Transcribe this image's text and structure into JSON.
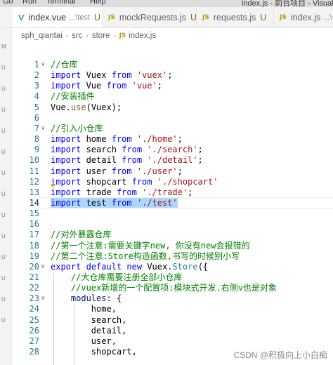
{
  "menubar": {
    "items": [
      "Go",
      "Run",
      "Terminal",
      "Help"
    ],
    "title": "index.js - 前台项目 - Visual S"
  },
  "tabs": [
    {
      "icon": "V",
      "kind": "vue",
      "label": "index.vue",
      "path": "...\\test",
      "modified": "U",
      "active": false
    },
    {
      "icon": "JS",
      "kind": "js",
      "label": "mockRequests.js",
      "path": "",
      "modified": "U",
      "active": false
    },
    {
      "icon": "JS",
      "kind": "js",
      "label": "requests.js",
      "path": "",
      "modified": "U",
      "active": false
    },
    {
      "icon": "JS",
      "kind": "js",
      "label": "index.js",
      "path": "...\\",
      "modified": "",
      "active": true
    }
  ],
  "breadcrumb": {
    "segments": [
      "sph_qiantai",
      "src",
      "store"
    ],
    "file_icon": "JS",
    "file": "index.js"
  },
  "editor": {
    "current_line": 14,
    "lines": [
      {
        "n": 1,
        "tokens": [
          [
            "cmt",
            "//仓库"
          ]
        ]
      },
      {
        "n": 2,
        "tokens": [
          [
            "kw",
            "import"
          ],
          [
            "",
            " Vuex "
          ],
          [
            "kw",
            "from"
          ],
          [
            "",
            " "
          ],
          [
            "str",
            "'vuex'"
          ],
          [
            "",
            ";"
          ]
        ]
      },
      {
        "n": 3,
        "tokens": [
          [
            "kw",
            "import"
          ],
          [
            "",
            " Vue "
          ],
          [
            "kw",
            "from"
          ],
          [
            "",
            " "
          ],
          [
            "str",
            "'vue'"
          ],
          [
            "",
            ";"
          ]
        ]
      },
      {
        "n": 4,
        "tokens": [
          [
            "cmt",
            "//安装插件"
          ]
        ]
      },
      {
        "n": 5,
        "tokens": [
          [
            "",
            "Vue."
          ],
          [
            "fn",
            "use"
          ],
          [
            "",
            "(Vuex);"
          ]
        ]
      },
      {
        "n": 6,
        "tokens": []
      },
      {
        "n": 7,
        "tokens": [
          [
            "cmt",
            "//引入小仓库"
          ]
        ]
      },
      {
        "n": 8,
        "tokens": [
          [
            "kw",
            "import"
          ],
          [
            "",
            " home "
          ],
          [
            "kw",
            "from"
          ],
          [
            "",
            " "
          ],
          [
            "str",
            "'./home'"
          ],
          [
            "",
            ";"
          ]
        ]
      },
      {
        "n": 9,
        "tokens": [
          [
            "kw",
            "import"
          ],
          [
            "",
            " search "
          ],
          [
            "kw",
            "from"
          ],
          [
            "",
            " "
          ],
          [
            "str",
            "'./search'"
          ],
          [
            "",
            ";"
          ]
        ]
      },
      {
        "n": 10,
        "tokens": [
          [
            "kw",
            "import"
          ],
          [
            "",
            " detail "
          ],
          [
            "kw",
            "from"
          ],
          [
            "",
            " "
          ],
          [
            "str",
            "'./detail'"
          ],
          [
            "",
            ";"
          ]
        ]
      },
      {
        "n": 11,
        "tokens": [
          [
            "kw",
            "import"
          ],
          [
            "",
            " user "
          ],
          [
            "kw",
            "from"
          ],
          [
            "",
            " "
          ],
          [
            "str",
            "'./user'"
          ],
          [
            "",
            ";"
          ]
        ]
      },
      {
        "n": 12,
        "tokens": [
          [
            "kw",
            "import"
          ],
          [
            "",
            " shopcart "
          ],
          [
            "kw",
            "from"
          ],
          [
            "",
            " "
          ],
          [
            "str",
            "'./shopcart'"
          ]
        ]
      },
      {
        "n": 13,
        "tokens": [
          [
            "kw",
            "import"
          ],
          [
            "",
            " trade "
          ],
          [
            "kw",
            "from"
          ],
          [
            "",
            " "
          ],
          [
            "str",
            "'./trade'"
          ],
          [
            "",
            ";"
          ]
        ]
      },
      {
        "n": 14,
        "selected": true,
        "tokens": [
          [
            "kw",
            "import"
          ],
          [
            "",
            " test "
          ],
          [
            "kw",
            "from"
          ],
          [
            "",
            " "
          ],
          [
            "str",
            "'./test'"
          ]
        ]
      },
      {
        "n": 15,
        "tokens": []
      },
      {
        "n": 16,
        "tokens": []
      },
      {
        "n": 17,
        "tokens": [
          [
            "cmt",
            "//对外暴露仓库"
          ]
        ]
      },
      {
        "n": 18,
        "tokens": [
          [
            "cmt",
            "//第一个注意:需要关键字new, 你没有new会报错的"
          ]
        ]
      },
      {
        "n": 19,
        "tokens": [
          [
            "cmt",
            "//第二个注意:Store构造函数,书写的时候别小写"
          ]
        ]
      },
      {
        "n": 20,
        "tokens": [
          [
            "kw",
            "export"
          ],
          [
            "",
            " "
          ],
          [
            "kw",
            "default"
          ],
          [
            "",
            " "
          ],
          [
            "kw",
            "new"
          ],
          [
            "",
            " Vuex."
          ],
          [
            "cls",
            "Store"
          ],
          [
            "",
            "({"
          ]
        ]
      },
      {
        "n": 21,
        "tokens": [
          [
            "",
            "    "
          ],
          [
            "cmt",
            "//大仓库需要注册全部小仓库"
          ]
        ]
      },
      {
        "n": 22,
        "tokens": [
          [
            "",
            "    "
          ],
          [
            "cmt",
            "//vuex新增的一个配置项:模块式开发.右侧v也是对象"
          ]
        ]
      },
      {
        "n": 23,
        "tokens": [
          [
            "",
            "    "
          ],
          [
            "ident",
            "modules"
          ],
          [
            "",
            ": {"
          ]
        ]
      },
      {
        "n": 24,
        "tokens": [
          [
            "",
            "        home,"
          ]
        ]
      },
      {
        "n": 25,
        "tokens": [
          [
            "",
            "        search,"
          ]
        ]
      },
      {
        "n": 26,
        "tokens": [
          [
            "",
            "        detail,"
          ]
        ]
      },
      {
        "n": 27,
        "tokens": [
          [
            "",
            "        user,"
          ]
        ]
      },
      {
        "n": 28,
        "tokens": [
          [
            "",
            "        shopcart,"
          ]
        ]
      }
    ]
  },
  "watermark": "CSDN @积极向上小白痴",
  "icons": [
    "vue-file-icon",
    "js-file-icon",
    "close-icon",
    "chevron-right-icon",
    "lightbulb-icon",
    "fold-chevron-icon"
  ]
}
